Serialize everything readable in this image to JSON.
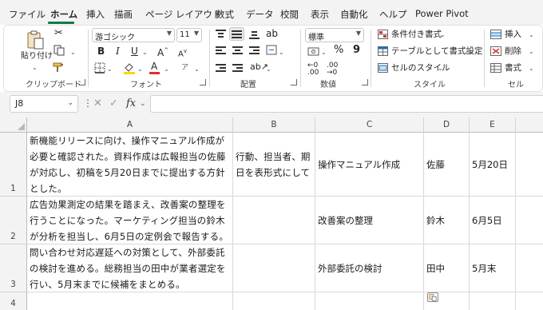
{
  "menu": {
    "items": [
      "ファイル",
      "ホーム",
      "挿入",
      "描画",
      "ページ レイアウト",
      "数式",
      "データ",
      "校閲",
      "表示",
      "自動化",
      "ヘルプ",
      "Power Pivot"
    ],
    "active": "ホーム"
  },
  "ribbon": {
    "clipboard": {
      "paste_label": "貼り付け",
      "group_label": "クリップボード"
    },
    "font": {
      "font_name": "游ゴシック",
      "font_size": "11",
      "bold": "B",
      "italic": "I",
      "underline": "U",
      "grow": "A",
      "shrink": "A",
      "font_color_letter": "A",
      "phonetic": "ア",
      "group_label": "フォント"
    },
    "alignment": {
      "group_label": "配置"
    },
    "number": {
      "format": "標準",
      "percent": "%",
      "comma": "9",
      "group_label": "数値"
    },
    "styles": {
      "conditional_format": "条件付き書式",
      "format_as_table": "テーブルとして書式設定",
      "cell_styles": "セルのスタイル",
      "group_label": "スタイル"
    },
    "cells": {
      "insert": "挿入",
      "delete": "削除",
      "format": "書式",
      "group_label": "セル"
    }
  },
  "formula_bar": {
    "name_box": "J8",
    "fx": "fx",
    "formula": ""
  },
  "grid": {
    "columns": [
      "A",
      "B",
      "C",
      "D",
      "E"
    ],
    "rows": [
      {
        "num": "1",
        "a": "新機能リリースに向け、操作マニュアル作成が必要と確認された。資料作成は広報担当の佐藤が対応し、初稿を5月20日までに提出する方針とした。",
        "b": "行動、担当者、期日を表形式にして",
        "c": "操作マニュアル作成",
        "d": "佐藤",
        "e": "5月20日"
      },
      {
        "num": "2",
        "a": "広告効果測定の結果を踏まえ、改善案の整理を行うことになった。マーケティング担当の鈴木が分析を担当し、6月5日の定例会で報告する。",
        "b": "",
        "c": "改善案の整理",
        "d": "鈴木",
        "e": "6月5日"
      },
      {
        "num": "3",
        "a": "問い合わせ対応遅延への対策として、外部委託の検討を進める。総務担当の田中が業者選定を行い、5月末までに候補をまとめる。",
        "b": "",
        "c": "外部委託の検討",
        "d": "田中",
        "e": "5月末"
      },
      {
        "num": "4",
        "a": "",
        "b": "",
        "c": "",
        "d": "",
        "e": ""
      }
    ]
  }
}
